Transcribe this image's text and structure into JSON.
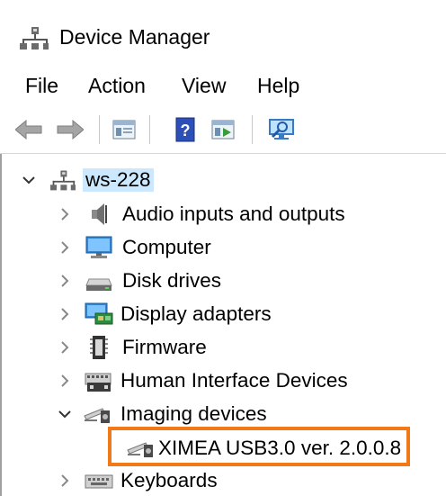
{
  "window": {
    "title": "Device Manager"
  },
  "menu": [
    {
      "label": "File"
    },
    {
      "label": "Action"
    },
    {
      "label": "View"
    },
    {
      "label": "Help"
    }
  ],
  "toolbar": {
    "buttons": [
      "back-icon",
      "forward-icon",
      "properties-icon",
      "help-icon",
      "update-driver-icon",
      "scan-hardware-icon"
    ]
  },
  "tree": {
    "root": {
      "label": "ws-228",
      "expanded": true
    },
    "items": [
      {
        "label": "Audio inputs and outputs",
        "icon": "speaker-icon",
        "expanded": false
      },
      {
        "label": "Computer",
        "icon": "monitor-icon",
        "expanded": false
      },
      {
        "label": "Disk drives",
        "icon": "disk-drive-icon",
        "expanded": false
      },
      {
        "label": "Display adapters",
        "icon": "display-adapter-icon",
        "expanded": false
      },
      {
        "label": "Firmware",
        "icon": "chip-icon",
        "expanded": false
      },
      {
        "label": "Human Interface Devices",
        "icon": "hid-icon",
        "expanded": false
      },
      {
        "label": "Imaging devices",
        "icon": "camera-icon",
        "expanded": true
      },
      {
        "label": "XIMEA USB3.0 ver. 2.0.0.8",
        "icon": "camera-icon",
        "child": true
      },
      {
        "label": "Keyboards",
        "icon": "keyboard-icon",
        "expanded": false
      }
    ]
  },
  "colors": {
    "selection": "#cce8ff",
    "highlight_box": "#f07a1a"
  }
}
